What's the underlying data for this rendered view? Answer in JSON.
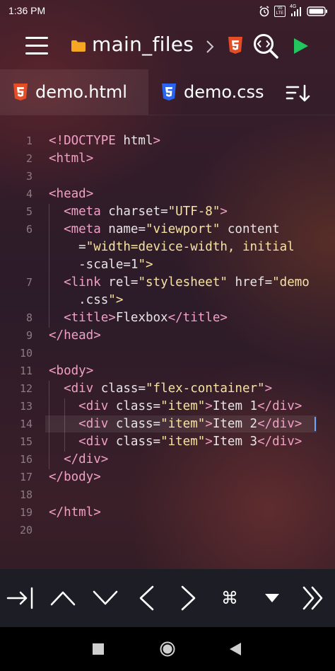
{
  "status_bar": {
    "time": "1:36 PM",
    "volte_label": "Vo LTE",
    "network_label": "4G"
  },
  "toolbar": {
    "folder_name": "main_files"
  },
  "tabs": [
    {
      "label": "demo.html",
      "icon": "html5-icon",
      "active": true
    },
    {
      "label": "demo.css",
      "icon": "css3-icon",
      "active": false
    }
  ],
  "editor": {
    "current_line": 14,
    "lines": [
      {
        "number": "1",
        "text": "<!DOCTYPE html>"
      },
      {
        "number": "2",
        "text": "<html>"
      },
      {
        "number": "3",
        "text": ""
      },
      {
        "number": "4",
        "text": "<head>"
      },
      {
        "number": "5",
        "text": "  <meta charset=\"UTF-8\">"
      },
      {
        "number": "6",
        "text": "  <meta name=\"viewport\" content"
      },
      {
        "number": "",
        "text": "    =\"width=device-width, initial"
      },
      {
        "number": "",
        "text": "    -scale=1\">"
      },
      {
        "number": "7",
        "text": "  <link rel=\"stylesheet\" href=\"demo"
      },
      {
        "number": "",
        "text": "    .css\">"
      },
      {
        "number": "8",
        "text": "  <title>Flexbox</title>"
      },
      {
        "number": "9",
        "text": "</head>"
      },
      {
        "number": "10",
        "text": ""
      },
      {
        "number": "11",
        "text": "<body>"
      },
      {
        "number": "12",
        "text": "  <div class=\"flex-container\">"
      },
      {
        "number": "13",
        "text": "    <div class=\"item\">Item 1</div>"
      },
      {
        "number": "14",
        "text": "    <div class=\"item\">Item 2</div>"
      },
      {
        "number": "15",
        "text": "    <div class=\"item\">Item 3</div>"
      },
      {
        "number": "16",
        "text": "  </div>"
      },
      {
        "number": "17",
        "text": "</body>"
      },
      {
        "number": "18",
        "text": ""
      },
      {
        "number": "19",
        "text": "</html>"
      },
      {
        "number": "20",
        "text": ""
      }
    ]
  },
  "keybar": {
    "keys": [
      {
        "name": "tab-key",
        "glyph": "→|"
      },
      {
        "name": "arrow-up-key",
        "glyph": "up"
      },
      {
        "name": "arrow-down-key",
        "glyph": "down"
      },
      {
        "name": "arrow-left-key",
        "glyph": "left"
      },
      {
        "name": "arrow-right-key",
        "glyph": "right"
      },
      {
        "name": "command-key",
        "glyph": "⌘"
      },
      {
        "name": "dropdown-key",
        "glyph": "▼"
      },
      {
        "name": "more-keys-key",
        "glyph": "»"
      }
    ]
  },
  "colors": {
    "html_icon": "#e44d26",
    "css_icon": "#2965f1",
    "run_button": "#22c55e",
    "folder": "#f5a623",
    "cursor": "#6aa8ff"
  }
}
